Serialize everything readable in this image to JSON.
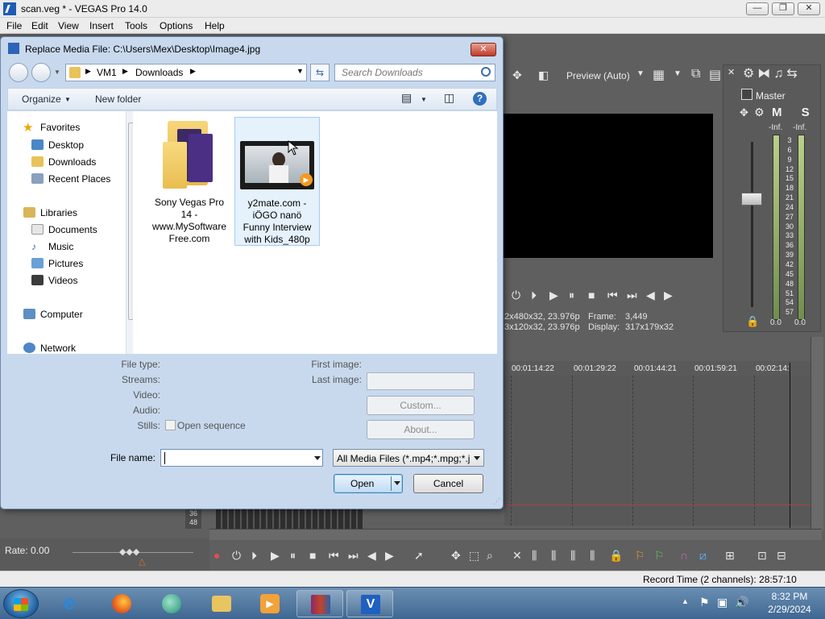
{
  "app": {
    "title": "scan.veg * - VEGAS Pro 14.0",
    "window_buttons": {
      "minimize": "—",
      "maximize": "❐",
      "close": "✕"
    },
    "menu": [
      "File",
      "Edit",
      "View",
      "Insert",
      "Tools",
      "Options",
      "Help"
    ]
  },
  "preview": {
    "quality_label": "Preview (Auto)",
    "project_info_1": "2x480x32, 23.976p",
    "project_info_2": "3x120x32, 23.976p",
    "frame_label": "Frame:",
    "frame_value": "3,449",
    "display_label": "Display:",
    "display_value": "317x179x32"
  },
  "master": {
    "title": "Master",
    "mute_solo": "M S",
    "inf_left": "-Inf.",
    "inf_right": "-Inf.",
    "scale": [
      "3",
      "6",
      "9",
      "12",
      "15",
      "18",
      "21",
      "24",
      "27",
      "30",
      "33",
      "36",
      "39",
      "42",
      "45",
      "48",
      "51",
      "54",
      "57"
    ],
    "zero_left": "0.0",
    "zero_right": "0.0"
  },
  "timeline": {
    "ruler": [
      "00:01:14:22",
      "00:01:29:22",
      "00:01:44:21",
      "00:01:59:21",
      "00:02:14:"
    ],
    "track_numbers": [
      "36",
      "48"
    ],
    "rate": "Rate: 0.00",
    "record_time": "Record Time (2 channels): 28:57:10"
  },
  "dialog": {
    "title": "Replace Media File: C:\\Users\\Mex\\Desktop\\Image4.jpg",
    "close": "✕",
    "breadcrumb": [
      "VM1",
      "Downloads"
    ],
    "search_placeholder": "Search Downloads",
    "organize": "Organize",
    "new_folder": "New folder",
    "nav": {
      "favorites": "Favorites",
      "desktop": "Desktop",
      "downloads": "Downloads",
      "recent_places": "Recent Places",
      "libraries": "Libraries",
      "documents": "Documents",
      "music": "Music",
      "pictures": "Pictures",
      "videos": "Videos",
      "computer": "Computer",
      "network": "Network"
    },
    "files": [
      {
        "name_line1": "Sony Vegas Pro",
        "name_line2": "14 -",
        "name_line3": "www.MySoftware",
        "name_line4": "Free.com"
      },
      {
        "name_line1": "y2mate.com -",
        "name_line2": "iÖGO nanö",
        "name_line3": "Funny Interview",
        "name_line4": "with Kids_480p"
      }
    ],
    "details": {
      "file_type": "File type:",
      "streams": "Streams:",
      "video": "Video:",
      "audio": "Audio:",
      "stills": "Stills:",
      "open_sequence": "Open sequence",
      "first_image": "First image:",
      "last_image": "Last image:",
      "custom": "Custom...",
      "about": "About..."
    },
    "file_name_label": "File name:",
    "file_name_value": "",
    "file_type_filter": "All Media Files (*.mp4;*.mpg;*.j",
    "open": "Open",
    "cancel": "Cancel"
  },
  "taskbar": {
    "time": "8:32 PM",
    "date": "2/29/2024"
  }
}
